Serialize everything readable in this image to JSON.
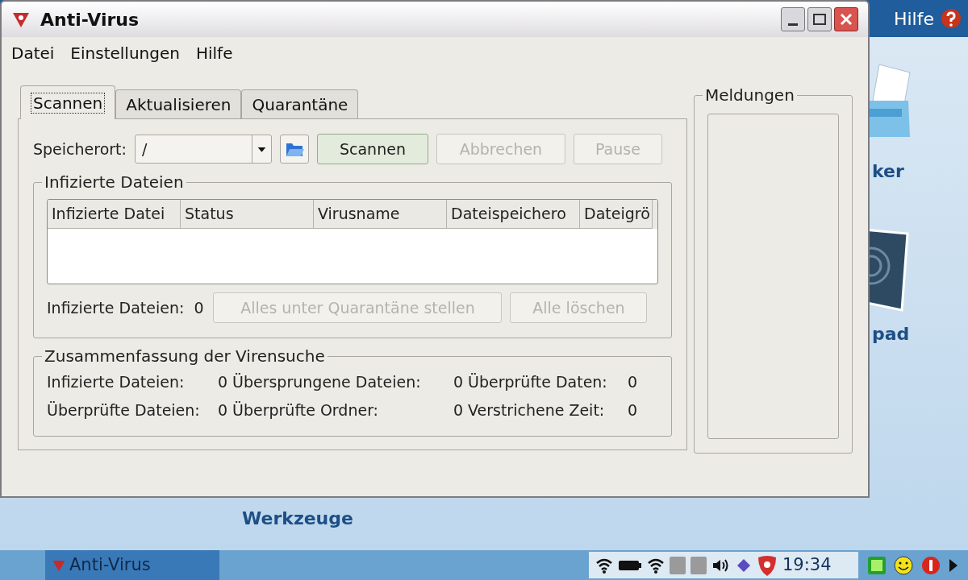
{
  "desktop": {
    "help_label": "Hilfe",
    "icon_labels": [
      {
        "label": "ker",
        "kind": "printer"
      },
      {
        "label": "pad",
        "kind": "touchpad"
      },
      {
        "label": "Werkzeuge",
        "kind": "text"
      }
    ]
  },
  "window": {
    "title": "Anti-Virus"
  },
  "menu": [
    "Datei",
    "Einstellungen",
    "Hilfe"
  ],
  "tabs": [
    {
      "label": "Scannen",
      "selected": true
    },
    {
      "label": "Aktualisieren",
      "selected": false
    },
    {
      "label": "Quarantäne",
      "selected": false
    }
  ],
  "location": {
    "label": "Speicherort:",
    "value": "/"
  },
  "buttons": [
    {
      "label": "Scannen",
      "disabled": false
    },
    {
      "label": "Abbrechen",
      "disabled": true
    },
    {
      "label": "Pause",
      "disabled": true
    }
  ],
  "infected": {
    "title": "Infizierte Dateien",
    "columns": [
      "Infizierte Datei",
      "Status",
      "Virusname",
      "Dateispeichero",
      "Dateigrö"
    ],
    "count_label": "Infizierte Dateien:",
    "count": "0",
    "buttons": [
      {
        "label": "Alles unter Quarantäne stellen",
        "disabled": true
      },
      {
        "label": "Alle löschen",
        "disabled": true
      }
    ]
  },
  "summary": {
    "title": "Zusammenfassung der Virensuche",
    "items": [
      {
        "label": "Infizierte Dateien:",
        "value": "0"
      },
      {
        "label": "Übersprungene Dateien:",
        "value": "0"
      },
      {
        "label": "Überprüfte Daten:",
        "value": "0"
      },
      {
        "label": "Überprüfte Dateien:",
        "value": "0"
      },
      {
        "label": "Überprüfte Ordner:",
        "value": "0"
      },
      {
        "label": "Verstrichene Zeit:",
        "value": "0"
      }
    ]
  },
  "messages": {
    "title": "Meldungen"
  },
  "taskbar": {
    "task": "Anti-Virus",
    "clock": "19:34"
  }
}
